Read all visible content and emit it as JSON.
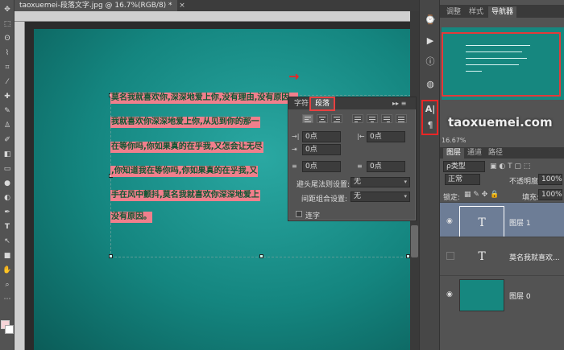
{
  "document": {
    "tab_title": "taoxuemei-段落文字.jpg @ 16.7%(RGB/8) *",
    "close": "×",
    "text_lines": [
      "莫名我就喜欢你,深深地爱上你,没有理由,没有原因。",
      "我就喜欢你深深地爱上你,从见到你的那一",
      "在等你吗,你如果真的在乎我,又怎会让无尽",
      ",你知道我在等你吗,你如果真的在乎我,又",
      "手在风中颤抖,莫名我就喜欢你深深地爱上",
      "没有原因。"
    ]
  },
  "paragraph_panel": {
    "tabs": [
      "字符",
      "段落"
    ],
    "menu": "▸▸ ≡",
    "indent_left": "0点",
    "indent_right": "0点",
    "indent_first": "0点",
    "space_before": "0点",
    "space_after": "0点",
    "kinsoku_label": "避头尾法则设置:",
    "kinsoku_value": "无",
    "mojikumi_label": "间距组合设置:",
    "mojikumi_value": "无",
    "hyphenate_label": "连字"
  },
  "navigator": {
    "tabs": [
      "调整",
      "样式",
      "导航器"
    ]
  },
  "watermark": "taoxuemei.com",
  "zoom": "16.67%",
  "layers": {
    "tabs": [
      "图层",
      "通道",
      "路径"
    ],
    "kind_filter": "ρ类型",
    "blend_mode": "正常",
    "opacity_label": "不透明度:",
    "opacity_value": "100%",
    "lock_label": "锁定:",
    "fill_label": "填充:",
    "fill_value": "100%",
    "items": [
      {
        "name": "图层 1",
        "thumb": "T"
      },
      {
        "name": "莫名我就喜欢...",
        "thumb": "T"
      },
      {
        "name": "图层 0",
        "thumb": ""
      }
    ]
  },
  "colors": {
    "highlight": "#f07f8c",
    "annotation": "#e82626",
    "canvas": "#14857f"
  }
}
